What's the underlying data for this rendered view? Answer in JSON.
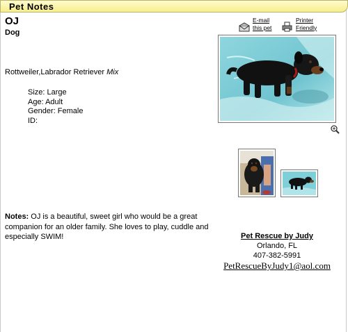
{
  "window": {
    "title": "Pet Notes"
  },
  "pet": {
    "name": "OJ",
    "species": "Dog",
    "breed": "Rottweiler,Labrador Retriever",
    "breed_suffix": "Mix",
    "size": "Size: Large",
    "age": "Age: Adult",
    "gender": "Gender: Female",
    "id": "ID:"
  },
  "actions": {
    "email_line1": "E-mail",
    "email_line2": "this pet",
    "print_line1": "Printer",
    "print_line2": "Friendly"
  },
  "notes": {
    "label": "Notes:",
    "text": "OJ is a beautiful, sweet girl who would be a great companion for an older family. She loves to play, cuddle and especially SWIM!"
  },
  "rescue": {
    "org": "Pet Rescue by Judy",
    "city": "Orlando, FL",
    "phone": "407-382-5991",
    "email": "PetRescueByJudy1@aol.com"
  },
  "icons": {
    "email": "envelope-icon",
    "print": "printer-icon",
    "zoom": "magnifier-icon"
  }
}
